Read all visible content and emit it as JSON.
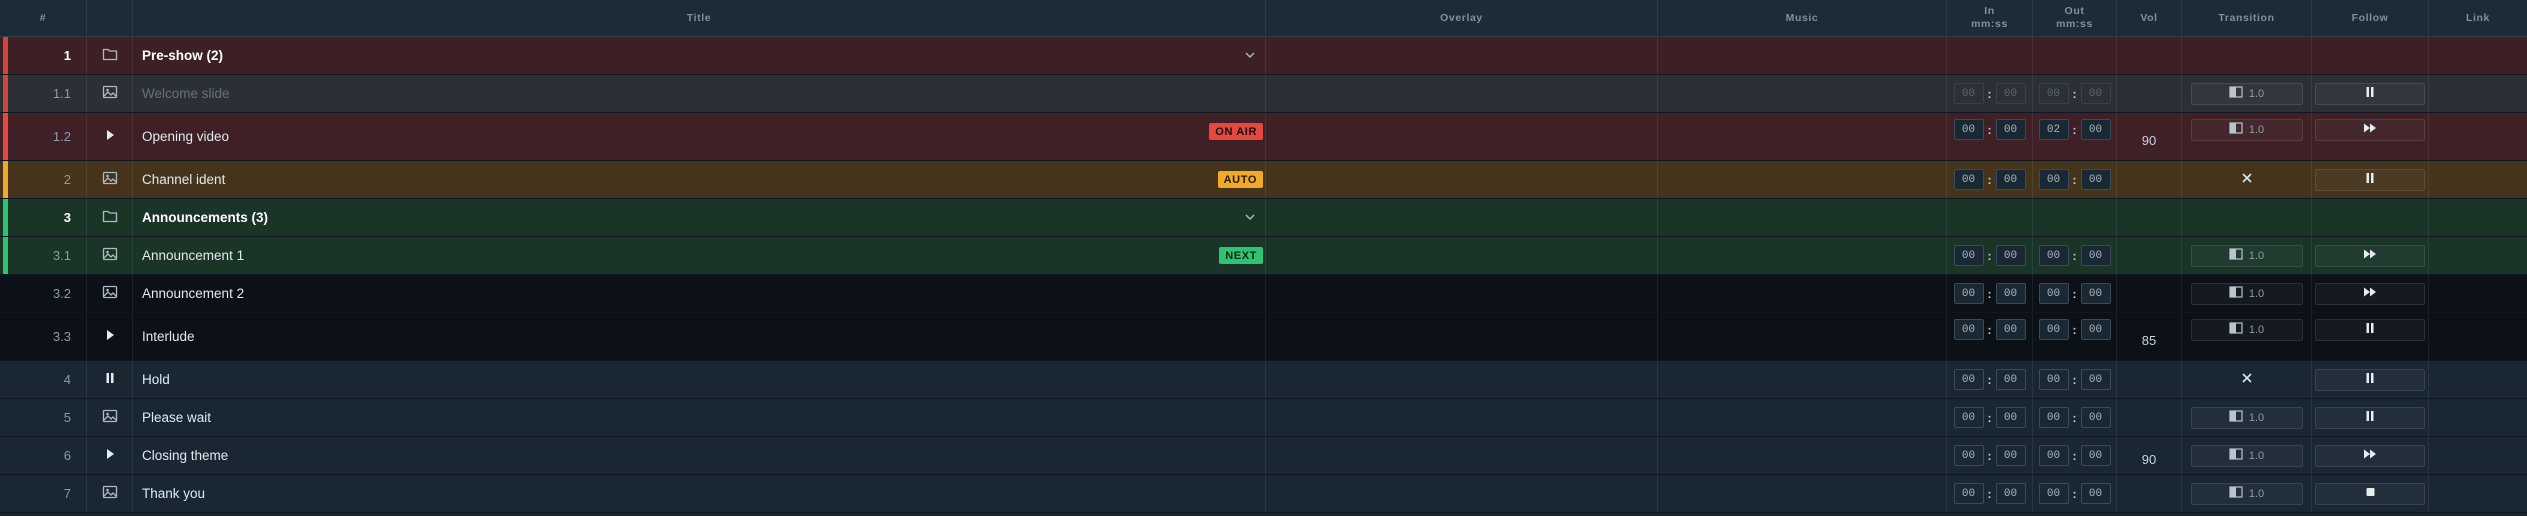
{
  "columns": {
    "num": "#",
    "title": "Title",
    "overlay": "Overlay",
    "music": "Music",
    "in_top": "In",
    "in_bottom": "mm:ss",
    "out_top": "Out",
    "out_bottom": "mm:ss",
    "vol": "Vol",
    "transition": "Transition",
    "follow": "Follow",
    "link": "Link"
  },
  "colors": {
    "red": "#e5483f",
    "orange": "#f1a92b",
    "green": "#2fc472"
  },
  "rows": [
    {
      "num": "1",
      "icon": "folder-icon",
      "title": "Pre-show  (2)",
      "group": true
    },
    {
      "num": "1.1",
      "icon": "image-icon",
      "title": "Welcome slide",
      "in": [
        "00",
        "00"
      ],
      "out": [
        "00",
        "00"
      ],
      "transition_value": "1.0",
      "follow_icon": "pause-icon"
    },
    {
      "num": "1.2",
      "icon": "play-icon",
      "title": "Opening video",
      "badge": "ON AIR",
      "in": [
        "00",
        "00"
      ],
      "out": [
        "02",
        "00"
      ],
      "vol": "90",
      "transition_value": "1.0",
      "follow_icon": "fast-forward-icon"
    },
    {
      "num": "2",
      "icon": "image-icon",
      "title": "Channel ident",
      "badge": "AUTO",
      "in": [
        "00",
        "00"
      ],
      "out": [
        "00",
        "00"
      ],
      "transition_icon": "cross-icon",
      "follow_icon": "pause-icon"
    },
    {
      "num": "3",
      "icon": "folder-icon",
      "title": "Announcements  (3)",
      "group": true
    },
    {
      "num": "3.1",
      "icon": "image-icon",
      "title": "Announcement 1",
      "badge": "NEXT",
      "in": [
        "00",
        "00"
      ],
      "out": [
        "00",
        "00"
      ],
      "transition_value": "1.0",
      "follow_icon": "fast-forward-icon"
    },
    {
      "num": "3.2",
      "icon": "image-icon",
      "title": "Announcement 2",
      "in": [
        "00",
        "00"
      ],
      "out": [
        "00",
        "00"
      ],
      "transition_value": "1.0",
      "follow_icon": "fast-forward-icon"
    },
    {
      "num": "3.3",
      "icon": "play-icon",
      "title": "Interlude",
      "in": [
        "00",
        "00"
      ],
      "out": [
        "00",
        "00"
      ],
      "vol": "85",
      "transition_value": "1.0",
      "follow_icon": "pause-icon"
    },
    {
      "num": "4",
      "icon": "pause-icon",
      "title": "Hold",
      "in": [
        "00",
        "00"
      ],
      "out": [
        "00",
        "00"
      ],
      "transition_icon": "cross-icon",
      "follow_icon": "pause-icon"
    },
    {
      "num": "5",
      "icon": "image-icon",
      "title": "Please wait",
      "in": [
        "00",
        "00"
      ],
      "out": [
        "00",
        "00"
      ],
      "transition_value": "1.0",
      "follow_icon": "pause-icon"
    },
    {
      "num": "6",
      "icon": "play-icon",
      "title": "Closing theme",
      "in": [
        "00",
        "00"
      ],
      "out": [
        "00",
        "00"
      ],
      "vol": "90",
      "transition_value": "1.0",
      "follow_icon": "fast-forward-icon"
    },
    {
      "num": "7",
      "icon": "image-icon",
      "title": "Thank you",
      "in": [
        "00",
        "00"
      ],
      "out": [
        "00",
        "00"
      ],
      "transition_value": "1.0",
      "follow_icon": "stop-icon"
    }
  ]
}
